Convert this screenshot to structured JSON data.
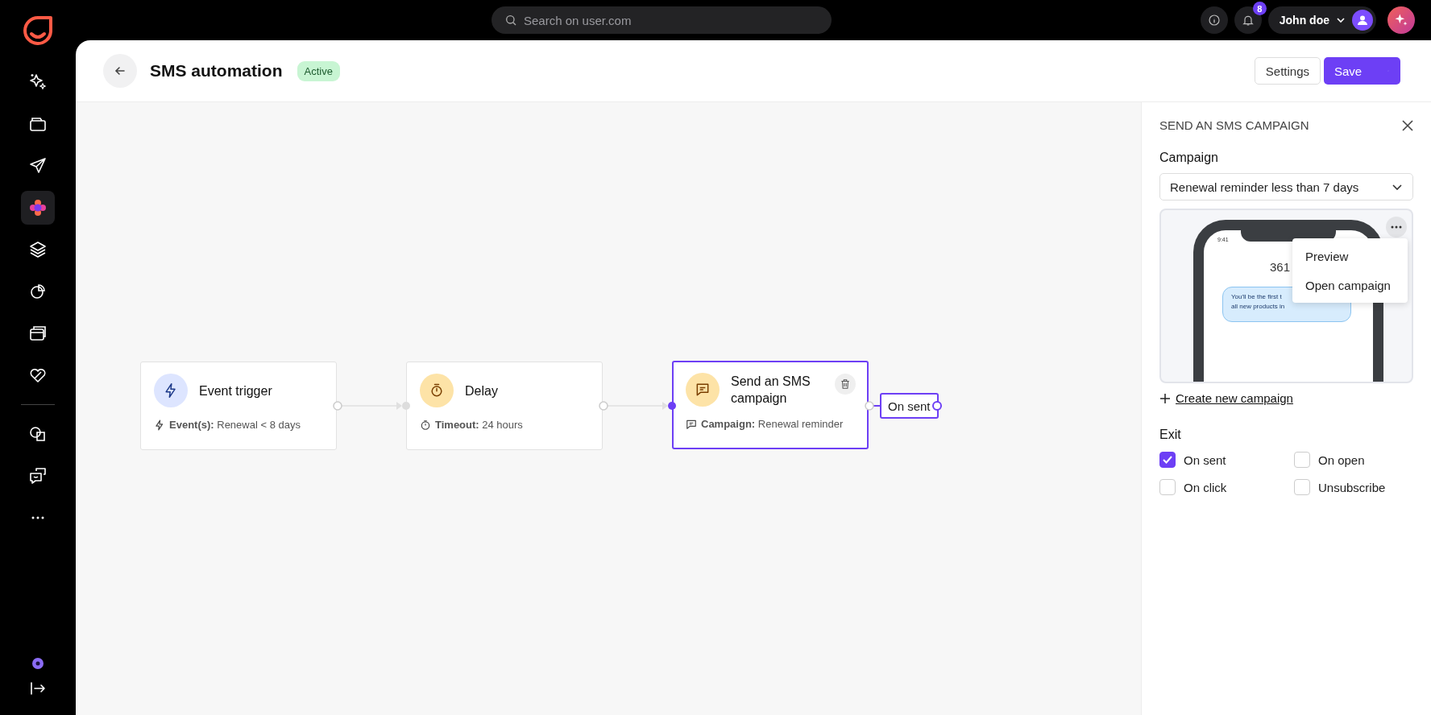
{
  "sidebar": {
    "items": [
      {
        "selected": false
      },
      {
        "selected": false
      },
      {
        "selected": false
      },
      {
        "selected": true
      },
      {
        "selected": false
      },
      {
        "selected": false
      },
      {
        "selected": false
      },
      {
        "selected": false
      },
      {
        "selected": false
      },
      {
        "selected": false
      },
      {
        "selected": false
      }
    ]
  },
  "topbar": {
    "search": {
      "placeholder": "Search on user.com"
    },
    "notification_count": "8",
    "user": "John doe"
  },
  "header": {
    "title": "SMS automation",
    "status": "Active",
    "buttons": [
      "Settings",
      "Save"
    ]
  },
  "nodes": [
    {
      "kind": "trigger",
      "title": "Event trigger",
      "detail_label": "Event(s):",
      "detail_value": "Renewal < 8 days",
      "selected": false
    },
    {
      "kind": "delay",
      "title": "Delay",
      "detail_label": "Timeout:",
      "detail_value": "24 hours",
      "selected": false
    },
    {
      "kind": "sms",
      "title": "Send an SMS campaign",
      "detail_label": "Campaign:",
      "detail_value": "Renewal reminder",
      "selected": true
    }
  ],
  "outputs": [
    "On sent"
  ],
  "panel": {
    "title": "SEND AN SMS CAMPAIGN",
    "campaign_label": "Campaign",
    "campaign_value": "Renewal reminder less than 7 days",
    "preview": {
      "time": "9:41",
      "sender": "361",
      "message_lines": [
        "You'll be the first t",
        "all new products in"
      ]
    },
    "menu": [
      "Preview",
      "Open campaign"
    ],
    "create_link": "Create new campaign",
    "exit_label": "Exit",
    "exit_options": [
      {
        "label": "On sent",
        "checked": true
      },
      {
        "label": "On open",
        "checked": false
      },
      {
        "label": "On click",
        "checked": false
      },
      {
        "label": "Unsubscribe",
        "checked": false
      }
    ]
  }
}
